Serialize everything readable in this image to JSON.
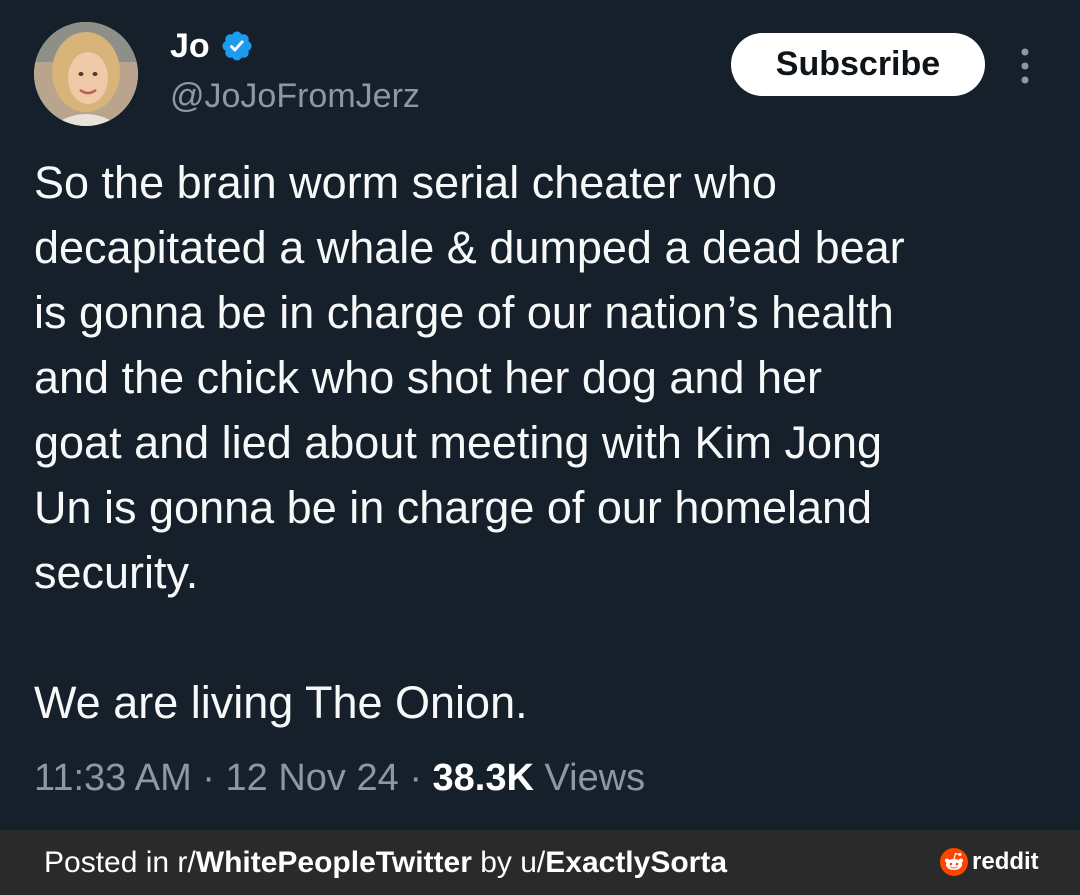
{
  "author": {
    "display_name": "Jo",
    "handle": "@JoJoFromJerz",
    "verified_icon": "verified-badge-icon",
    "avatar_icon": "avatar"
  },
  "actions": {
    "subscribe_label": "Subscribe",
    "more_icon": "more-vertical-icon"
  },
  "tweet": {
    "text": "So the brain worm serial cheater who\ndecapitated a whale & dumped a dead bear\nis gonna be in charge of our nation’s health\nand the chick who shot her dog and her\ngoat and lied about meeting with Kim Jong\nUn is gonna be in charge of our homeland\nsecurity.\n\nWe are living The Onion.",
    "time": "11:33 AM",
    "separator": "·",
    "date": "12 Nov 24",
    "views_count": "38.3K",
    "views_label": "Views"
  },
  "footer": {
    "posted_in_label": "Posted in r/",
    "subreddit": "WhitePeopleTwitter",
    "by_label": " by u/",
    "username": "ExactlySorta",
    "brand": "reddit"
  },
  "colors": {
    "background": "#15202b",
    "verified_blue": "#1d9bf0",
    "muted_text": "#8b98a5",
    "footer_bg": "#2a2a2a",
    "reddit_orange": "#ff4500"
  }
}
